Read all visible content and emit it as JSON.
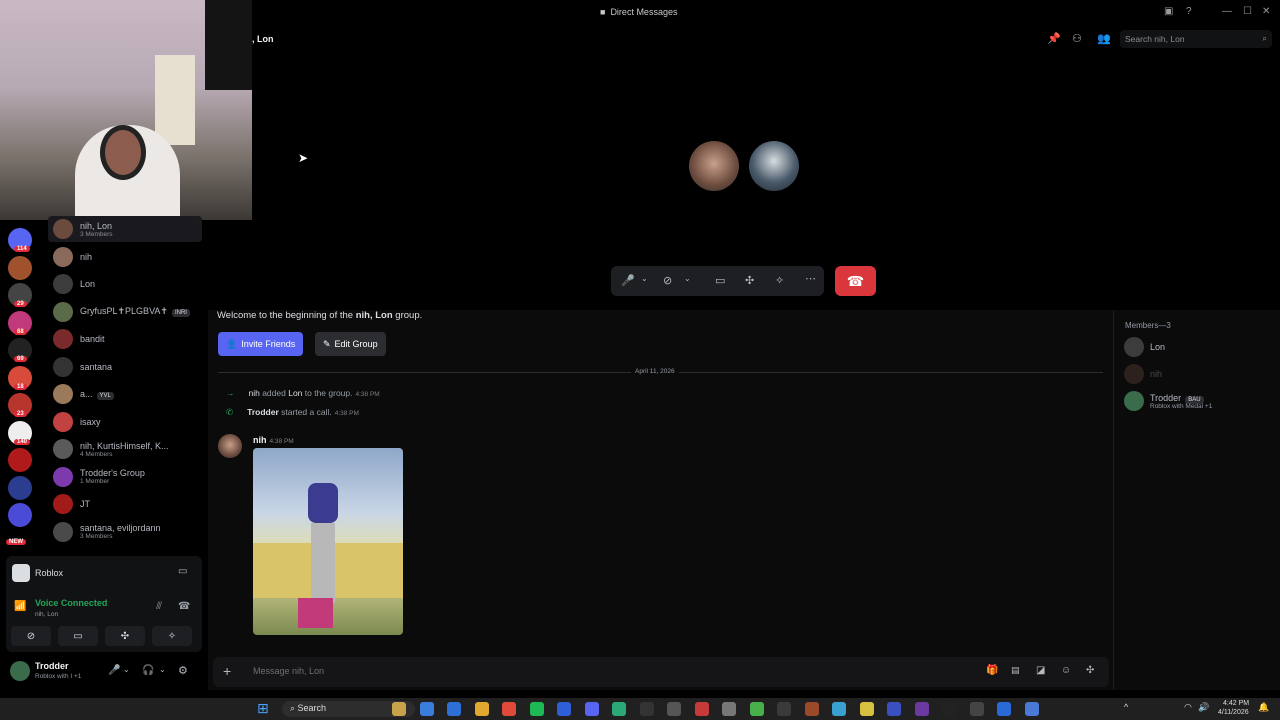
{
  "window": {
    "title": "Direct Messages"
  },
  "header": {
    "title": ", Lon",
    "search_placeholder": "Search nih, Lon"
  },
  "servers": [
    {
      "badge": "114",
      "color": "#5865f2"
    },
    {
      "badge": "",
      "color": "#a0522d"
    },
    {
      "badge": "29",
      "color": "#444"
    },
    {
      "badge": "68",
      "color": "#c0397a"
    },
    {
      "badge": "69",
      "color": "#222"
    },
    {
      "badge": "18",
      "color": "#d84a3a"
    },
    {
      "badge": "23",
      "color": "#b8352e"
    },
    {
      "badge": "140",
      "color": "#eee"
    },
    {
      "badge": "",
      "color": "#b01a1a"
    },
    {
      "badge": "",
      "color": "#2a3d8f"
    },
    {
      "badge": "",
      "color": "#4a4bd6"
    }
  ],
  "new_badge": "NEW",
  "dms": [
    {
      "name": "nih, Lon",
      "sub": "3 Members",
      "color": "#6b4b3e"
    },
    {
      "name": "nih",
      "sub": "",
      "color": "#8a6a5a"
    },
    {
      "name": "Lon",
      "sub": "",
      "color": "#3c3c3c"
    },
    {
      "name": "GryfusPL✝PLGBVA✝",
      "sub": "",
      "tag": "INRI",
      "color": "#5a6b4a"
    },
    {
      "name": "bandit",
      "sub": "",
      "color": "#7a2a2a"
    },
    {
      "name": "santana",
      "sub": "",
      "color": "#333"
    },
    {
      "name": "a...",
      "sub": "",
      "tag": "YVL",
      "color": "#9a7a5a"
    },
    {
      "name": "isaxy",
      "sub": "",
      "color": "#c24242"
    },
    {
      "name": "nih, KurtisHimself, K...",
      "sub": "4 Members",
      "color": "#5a5a5a"
    },
    {
      "name": "Trodder's Group",
      "sub": "1 Member",
      "color": "#7c3aad"
    },
    {
      "name": "JT",
      "sub": "",
      "color": "#a11b1b"
    },
    {
      "name": "santana, eviljordann",
      "sub": "3 Members",
      "color": "#4a4a4a"
    }
  ],
  "activity": {
    "game": "Roblox"
  },
  "voice": {
    "status": "Voice Connected",
    "channel": "nih, Lon"
  },
  "user": {
    "name": "Trodder",
    "status": "Roblox with I +1"
  },
  "chat": {
    "welcome_prefix": "Welcome to the beginning of the ",
    "welcome_group": "nih, Lon",
    "welcome_suffix": " group.",
    "invite_label": "Invite Friends",
    "edit_label": "Edit Group",
    "date_divider": "April 11, 2026",
    "sys1_actor": "nih",
    "sys1_mid": " added ",
    "sys1_target": "Lon",
    "sys1_end": " to the group.",
    "sys1_time": "4:38 PM",
    "sys2_actor": "Trodder",
    "sys2_end": " started a call.",
    "sys2_time": "4:38 PM",
    "msg_author": "nih",
    "msg_time": "4:38 PM",
    "input_placeholder": "Message nih, Lon"
  },
  "members": {
    "header": "Members—3",
    "list": [
      {
        "name": "Lon",
        "sub": "",
        "color": "#3c3c3c"
      },
      {
        "name": "nih",
        "sub": "",
        "color": "#6b4b3e"
      },
      {
        "name": "Trodder",
        "tag": "BAU",
        "sub": "Roblox with Medal +1",
        "color": "#3a6b4a"
      }
    ]
  },
  "taskbar": {
    "search": "Search",
    "time": "4:42 PM",
    "date": "4/11/2026"
  },
  "colors": {
    "accent": "#5865f2",
    "danger": "#da373c",
    "online": "#23a55a"
  }
}
